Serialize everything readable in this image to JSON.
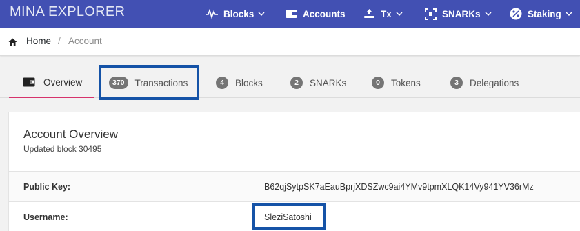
{
  "navbar": {
    "brand": "MINA EXPLORER",
    "items": [
      {
        "label": "Blocks",
        "icon": "pulse-icon",
        "has_dropdown": true
      },
      {
        "label": "Accounts",
        "icon": "wallet-icon",
        "has_dropdown": false
      },
      {
        "label": "Tx",
        "icon": "transfer-icon",
        "has_dropdown": true
      },
      {
        "label": "SNARKs",
        "icon": "snark-icon",
        "has_dropdown": true
      },
      {
        "label": "Staking",
        "icon": "percent-icon",
        "has_dropdown": true
      }
    ]
  },
  "breadcrumb": {
    "home": "Home",
    "separator": "/",
    "current": "Account"
  },
  "tabs": [
    {
      "label": "Overview",
      "icon": "wallet-icon",
      "active": true
    },
    {
      "label": "Transactions",
      "count": "370"
    },
    {
      "label": "Blocks",
      "count": "4"
    },
    {
      "label": "SNARKs",
      "count": "2"
    },
    {
      "label": "Tokens",
      "count": "0"
    },
    {
      "label": "Delegations",
      "count": "3"
    }
  ],
  "overview": {
    "title": "Account Overview",
    "updated": "Updated block 30495",
    "rows": [
      {
        "label": "Public Key:",
        "value": "B62qjSytpSK7aEauBprjXDSZwc9ai4YMv9tpmXLQK14Vy941YV36rMz"
      },
      {
        "label": "Username:",
        "value": "SleziSatoshi"
      }
    ]
  },
  "colors": {
    "navbar": "#4250b3",
    "active_tab_underline": "#d6336c",
    "highlight": "#1553a7",
    "badge": "#757575"
  }
}
